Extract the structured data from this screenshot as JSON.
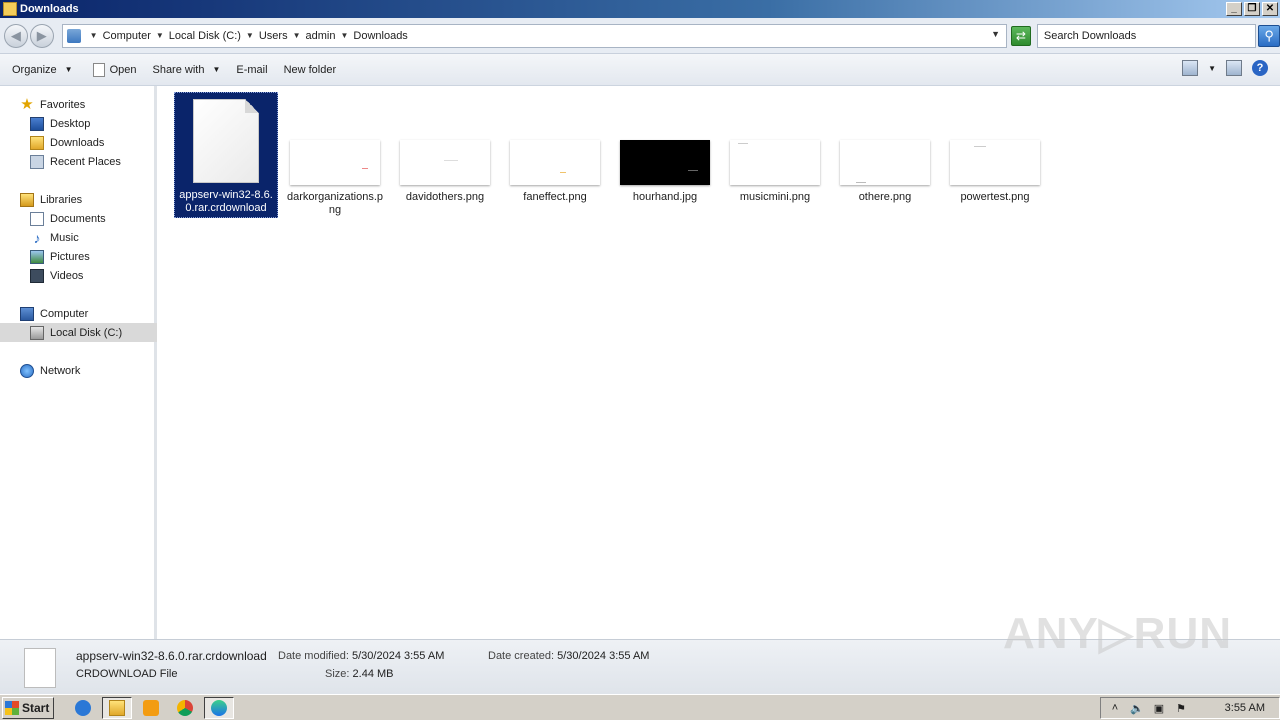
{
  "window": {
    "title": "Downloads",
    "buttons": {
      "minimize": "_",
      "maximize": "❐",
      "close": "✕"
    }
  },
  "address": {
    "crumbs": [
      "Computer",
      "Local Disk (C:)",
      "Users",
      "admin",
      "Downloads"
    ],
    "search_placeholder": "Search Downloads"
  },
  "toolbar": {
    "organize": "Organize",
    "open": "Open",
    "share_with": "Share with",
    "email": "E-mail",
    "new_folder": "New folder"
  },
  "nav": {
    "favorites": "Favorites",
    "desktop": "Desktop",
    "downloads": "Downloads",
    "recent_places": "Recent Places",
    "libraries": "Libraries",
    "documents": "Documents",
    "music": "Music",
    "pictures": "Pictures",
    "videos": "Videos",
    "computer": "Computer",
    "local_disk": "Local Disk (C:)",
    "network": "Network"
  },
  "files": [
    {
      "name": "appserv-win32-8.6.0.rar.crdownload"
    },
    {
      "name": "darkorganizations.png"
    },
    {
      "name": "davidothers.png"
    },
    {
      "name": "faneffect.png"
    },
    {
      "name": "hourhand.jpg"
    },
    {
      "name": "musicmini.png"
    },
    {
      "name": "othere.png"
    },
    {
      "name": "powertest.png"
    }
  ],
  "details": {
    "name": "appserv-win32-8.6.0.rar.crdownload",
    "type": "CRDOWNLOAD File",
    "date_modified_label": "Date modified:",
    "date_modified": "5/30/2024 3:55 AM",
    "date_created_label": "Date created:",
    "date_created": "5/30/2024 3:55 AM",
    "size_label": "Size:",
    "size": "2.44 MB"
  },
  "watermark": "ANY▷RUN",
  "taskbar": {
    "start": "Start",
    "clock": "3:55 AM"
  }
}
